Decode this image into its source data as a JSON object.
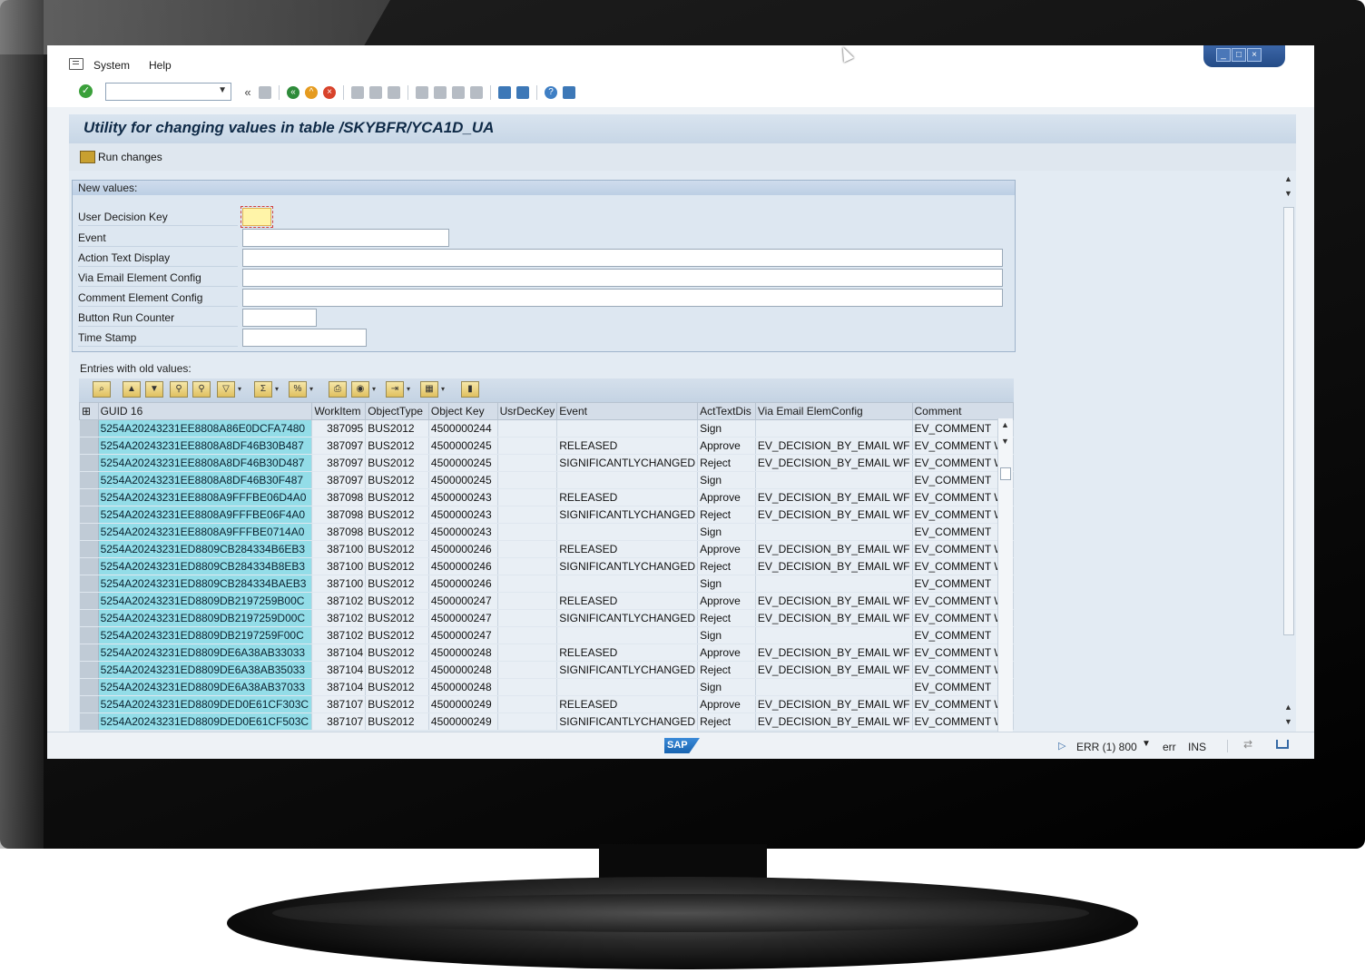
{
  "menu": {
    "items": [
      "System",
      "Help"
    ]
  },
  "toolbar": {
    "command_value": ""
  },
  "title": "Utility for changing values in table /SKYBFR/YCA1D_UA",
  "app_toolbar": {
    "run_changes": "Run changes"
  },
  "new_values": {
    "group_title": "New values:",
    "fields": [
      {
        "label": "User Decision Key",
        "value": ""
      },
      {
        "label": "Event",
        "value": ""
      },
      {
        "label": "Action Text Display",
        "value": ""
      },
      {
        "label": "Via Email Element Config",
        "value": ""
      },
      {
        "label": "Comment Element Config",
        "value": ""
      },
      {
        "label": "Button Run Counter",
        "value": ""
      },
      {
        "label": "Time Stamp",
        "value": ""
      }
    ]
  },
  "old_values": {
    "label": "Entries with old values:",
    "columns": [
      "GUID 16",
      "WorkItem",
      "ObjectType",
      "Object Key",
      "UsrDecKey",
      "Event",
      "ActTextDis",
      "Via Email ElemConfig",
      "Comment"
    ],
    "rows": [
      [
        "5254A20243231EE8808A86E0DCFA7480",
        "387095",
        "BUS2012",
        "4500000244",
        "",
        "",
        "Sign",
        "",
        "EV_COMMENT"
      ],
      [
        "5254A20243231EE8808A8DF46B30B487",
        "387097",
        "BUS2012",
        "4500000245",
        "",
        "RELEASED",
        "Approve",
        "EV_DECISION_BY_EMAIL WF",
        "EV_COMMENT WF"
      ],
      [
        "5254A20243231EE8808A8DF46B30D487",
        "387097",
        "BUS2012",
        "4500000245",
        "",
        "SIGNIFICANTLYCHANGED",
        "Reject",
        "EV_DECISION_BY_EMAIL WF",
        "EV_COMMENT WF"
      ],
      [
        "5254A20243231EE8808A8DF46B30F487",
        "387097",
        "BUS2012",
        "4500000245",
        "",
        "",
        "Sign",
        "",
        "EV_COMMENT"
      ],
      [
        "5254A20243231EE8808A9FFFBE06D4A0",
        "387098",
        "BUS2012",
        "4500000243",
        "",
        "RELEASED",
        "Approve",
        "EV_DECISION_BY_EMAIL WF",
        "EV_COMMENT WF"
      ],
      [
        "5254A20243231EE8808A9FFFBE06F4A0",
        "387098",
        "BUS2012",
        "4500000243",
        "",
        "SIGNIFICANTLYCHANGED",
        "Reject",
        "EV_DECISION_BY_EMAIL WF",
        "EV_COMMENT WF"
      ],
      [
        "5254A20243231EE8808A9FFFBE0714A0",
        "387098",
        "BUS2012",
        "4500000243",
        "",
        "",
        "Sign",
        "",
        "EV_COMMENT"
      ],
      [
        "5254A20243231ED8809CB284334B6EB3",
        "387100",
        "BUS2012",
        "4500000246",
        "",
        "RELEASED",
        "Approve",
        "EV_DECISION_BY_EMAIL WF",
        "EV_COMMENT WF"
      ],
      [
        "5254A20243231ED8809CB284334B8EB3",
        "387100",
        "BUS2012",
        "4500000246",
        "",
        "SIGNIFICANTLYCHANGED",
        "Reject",
        "EV_DECISION_BY_EMAIL WF",
        "EV_COMMENT WF"
      ],
      [
        "5254A20243231ED8809CB284334BAEB3",
        "387100",
        "BUS2012",
        "4500000246",
        "",
        "",
        "Sign",
        "",
        "EV_COMMENT"
      ],
      [
        "5254A20243231ED8809DB2197259B00C",
        "387102",
        "BUS2012",
        "4500000247",
        "",
        "RELEASED",
        "Approve",
        "EV_DECISION_BY_EMAIL WF",
        "EV_COMMENT WF"
      ],
      [
        "5254A20243231ED8809DB2197259D00C",
        "387102",
        "BUS2012",
        "4500000247",
        "",
        "SIGNIFICANTLYCHANGED",
        "Reject",
        "EV_DECISION_BY_EMAIL WF",
        "EV_COMMENT WF"
      ],
      [
        "5254A20243231ED8809DB2197259F00C",
        "387102",
        "BUS2012",
        "4500000247",
        "",
        "",
        "Sign",
        "",
        "EV_COMMENT"
      ],
      [
        "5254A20243231ED8809DE6A38AB33033",
        "387104",
        "BUS2012",
        "4500000248",
        "",
        "RELEASED",
        "Approve",
        "EV_DECISION_BY_EMAIL WF",
        "EV_COMMENT WF"
      ],
      [
        "5254A20243231ED8809DE6A38AB35033",
        "387104",
        "BUS2012",
        "4500000248",
        "",
        "SIGNIFICANTLYCHANGED",
        "Reject",
        "EV_DECISION_BY_EMAIL WF",
        "EV_COMMENT WF"
      ],
      [
        "5254A20243231ED8809DE6A38AB37033",
        "387104",
        "BUS2012",
        "4500000248",
        "",
        "",
        "Sign",
        "",
        "EV_COMMENT"
      ],
      [
        "5254A20243231ED8809DED0E61CF303C",
        "387107",
        "BUS2012",
        "4500000249",
        "",
        "RELEASED",
        "Approve",
        "EV_DECISION_BY_EMAIL WF",
        "EV_COMMENT WF"
      ],
      [
        "5254A20243231ED8809DED0E61CF503C",
        "387107",
        "BUS2012",
        "4500000249",
        "",
        "SIGNIFICANTLYCHANGED",
        "Reject",
        "EV_DECISION_BY_EMAIL WF",
        "EV_COMMENT WF"
      ]
    ]
  },
  "status": {
    "logo": "SAP",
    "system": "ERR (1) 800",
    "client": "err",
    "mode": "INS"
  }
}
